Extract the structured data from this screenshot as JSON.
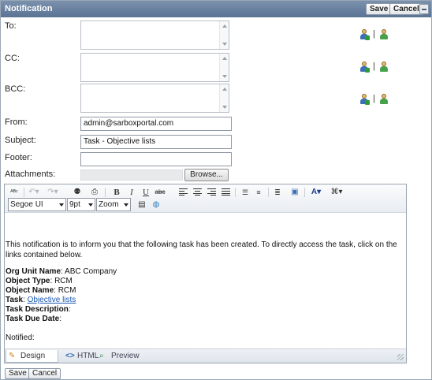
{
  "window": {
    "title": "Notification",
    "save_label": "Save",
    "cancel_label": "Cancel"
  },
  "form": {
    "to_label": "To:",
    "cc_label": "CC:",
    "bcc_label": "BCC:",
    "from_label": "From:",
    "from_value": "admin@sarboxportal.com",
    "subject_label": "Subject:",
    "subject_value": "Task - Objective lists",
    "footer_label": "Footer:",
    "footer_value": "",
    "attachments_label": "Attachments:",
    "browse_label": "Browse...",
    "address_separator": "|"
  },
  "editor": {
    "font_select": "Segoe UI",
    "size_select": "9pt",
    "zoom_select": "Zoom",
    "intro_text": "This notification is to inform you that the following task has been created. To directly access the task, click on the links contained below.",
    "rows": [
      {
        "label": "Org Unit Name",
        "value": "ABC Company"
      },
      {
        "label": "Object Type",
        "value": "RCM"
      },
      {
        "label": "Object Name",
        "value": "RCM"
      },
      {
        "label": "Task",
        "value": "Objective lists"
      },
      {
        "label": "Task Description",
        "value": ""
      },
      {
        "label": "Task Due Date",
        "value": ""
      }
    ],
    "notified_label": "Notified:",
    "modes": {
      "design": "Design",
      "html": "HTML",
      "preview": "Preview"
    }
  },
  "footer_buttons": {
    "save_label": "Save",
    "cancel_label": "Cancel"
  },
  "colors": {
    "title_bar": "#5a7394",
    "link": "#1a57b3"
  }
}
